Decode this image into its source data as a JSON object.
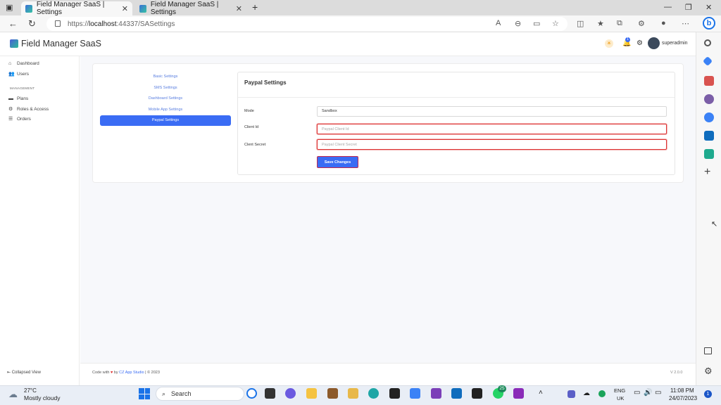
{
  "browser": {
    "tabs": [
      {
        "title": "Field Manager SaaS | Settings",
        "active": true
      },
      {
        "title": "Field Manager SaaS | Settings",
        "active": false
      }
    ],
    "new_tab": "+",
    "url_scheme": "https://",
    "url_host": "localhost",
    "url_rest": ":44337/SASettings"
  },
  "app": {
    "brand": "Field Manager SaaS",
    "notification_count": "1",
    "username": "superadmin"
  },
  "sidebar": {
    "items_top": [
      {
        "label": "Dashboard",
        "icon": "home-icon"
      },
      {
        "label": "Users",
        "icon": "users-icon"
      }
    ],
    "section_heading": "MANAGEMENT",
    "items_management": [
      {
        "label": "Plans",
        "icon": "plans-icon"
      },
      {
        "label": "Roles & Access",
        "icon": "roles-icon"
      },
      {
        "label": "Orders",
        "icon": "orders-icon"
      }
    ],
    "collapse_label": "Collapsed View"
  },
  "settings_nav": {
    "links": [
      "Basic Settings",
      "SMS Settings",
      "Dashboard Settings",
      "Mobile App Settings"
    ],
    "active": "Paypal Settings"
  },
  "paypal": {
    "title": "Paypal Settings",
    "mode_label": "Mode",
    "mode_value": "Sandbox",
    "client_id_label": "Client Id",
    "client_id_placeholder": "Paypal Client Id",
    "client_secret_label": "Clent Secret",
    "client_secret_placeholder": "Paypal Client Secret",
    "save_label": "Save Changes"
  },
  "footer": {
    "code_with": "Code with",
    "by": "by",
    "studio": "CZ App Studio",
    "copyright": "| © 2023",
    "version": "V 2.0.0"
  },
  "taskbar": {
    "temperature": "27°C",
    "weather": "Mostly cloudy",
    "search": "Search",
    "whatsapp_badge": "25",
    "lang": "ENG",
    "region": "UK",
    "time": "11:08 PM",
    "date": "24/07/2023",
    "notifications": "1"
  },
  "colors": {
    "accent": "#3a6cf4",
    "error": "#d33333"
  }
}
